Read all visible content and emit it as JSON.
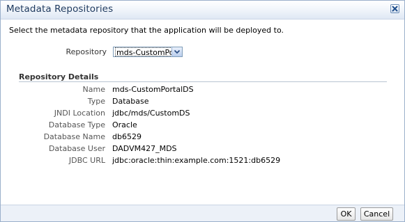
{
  "dialog": {
    "title": "Metadata Repositories",
    "close_icon": "close-icon",
    "instruction": "Select the metadata repository that the application will be deployed to."
  },
  "repository": {
    "label": "Repository",
    "selected": "mds-CustomPor",
    "dropdown_icon": "chevron-down-icon"
  },
  "details": {
    "section_title": "Repository Details",
    "rows": [
      {
        "label": "Name",
        "value": "mds-CustomPortalDS"
      },
      {
        "label": "Type",
        "value": "Database"
      },
      {
        "label": "JNDI Location",
        "value": "jdbc/mds/CustomDS"
      },
      {
        "label": "Database Type",
        "value": "Oracle"
      },
      {
        "label": "Database Name",
        "value": "db6529"
      },
      {
        "label": "Database User",
        "value": "DADVM427_MDS"
      },
      {
        "label": "JDBC URL",
        "value": "jdbc:oracle:thin:example.com:1521:db6529"
      }
    ]
  },
  "footer": {
    "ok_label": "OK",
    "cancel_label": "Cancel"
  },
  "colors": {
    "title_text": "#1f3a5f",
    "close_icon": "#1f4e8c",
    "footer_bg": "#ecf1f8"
  }
}
